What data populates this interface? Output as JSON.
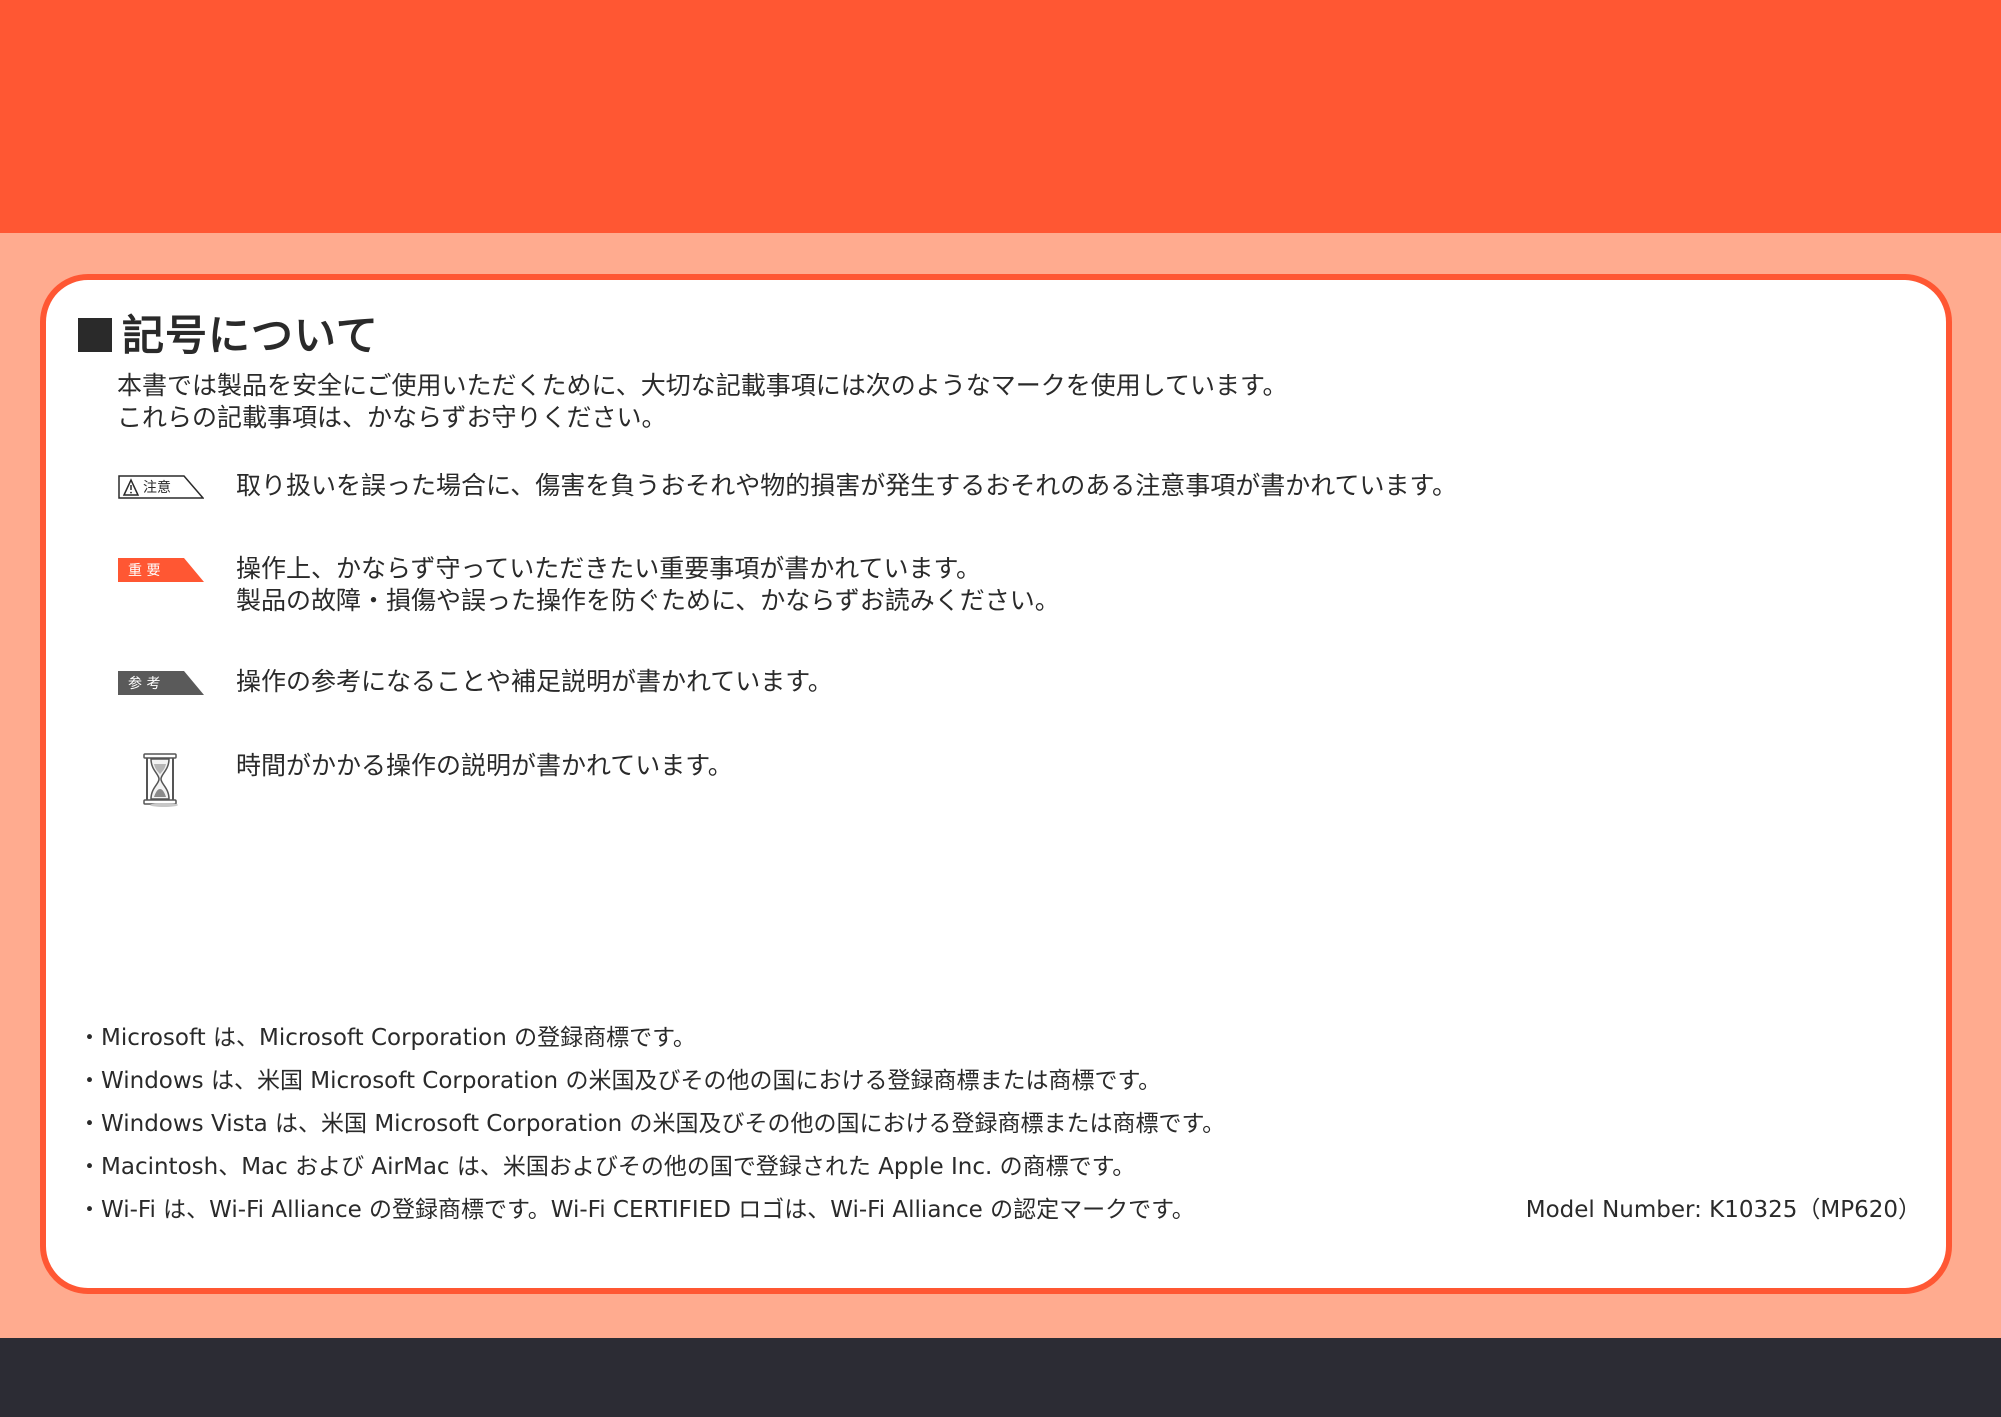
{
  "colors": {
    "header_band": "#ff5733",
    "page_background": "#ffab8f",
    "footer_band": "#2c2c34",
    "panel_border": "#ff5733",
    "important_badge": "#ff5733",
    "reference_badge": "#5a5a5a"
  },
  "section": {
    "title": "記号について",
    "intro": [
      "本書では製品を安全にご使用いただくために、大切な記載事項には次のようなマークを使用しています。",
      "これらの記載事項は、かならずお守りください。"
    ]
  },
  "marks": [
    {
      "badge": "注意",
      "icon": "caution-triangle-icon",
      "lines": [
        "取り扱いを誤った場合に、傷害を負うおそれや物的損害が発生するおそれのある注意事項が書かれています。"
      ]
    },
    {
      "badge": "重 要",
      "icon": "important-badge-icon",
      "lines": [
        "操作上、かならず守っていただきたい重要事項が書かれています。",
        "製品の故障・損傷や誤った操作を防ぐために、かならずお読みください。"
      ]
    },
    {
      "badge": "参 考",
      "icon": "reference-badge-icon",
      "lines": [
        "操作の参考になることや補足説明が書かれています。"
      ]
    },
    {
      "badge": "",
      "icon": "hourglass-icon",
      "lines": [
        "時間がかかる操作の説明が書かれています。"
      ]
    }
  ],
  "trademarks": {
    "bullet": "・",
    "items": [
      "Microsoft は、Microsoft Corporation の登録商標です。",
      "Windows は、米国 Microsoft Corporation の米国及びその他の国における登録商標または商標です。",
      "Windows Vista は、米国 Microsoft Corporation の米国及びその他の国における登録商標または商標です。",
      "Macintosh、Mac および AirMac は、米国およびその他の国で登録された Apple Inc. の商標です。",
      "Wi-Fi は、Wi-Fi Alliance の登録商標です。Wi-Fi CERTIFIED ロゴは、Wi-Fi Alliance の認定マークです。"
    ]
  },
  "model_number": "Model Number: K10325（MP620）"
}
